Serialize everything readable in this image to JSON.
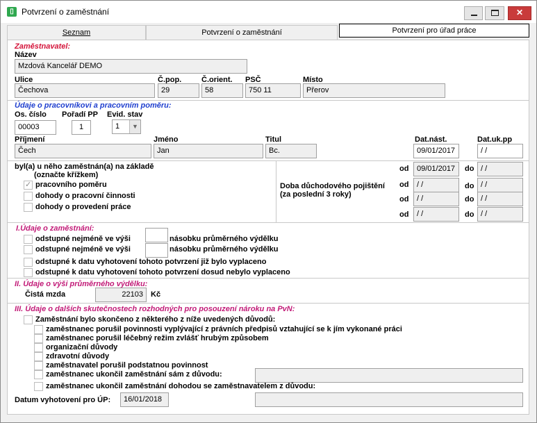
{
  "window": {
    "title": "Potvrzení o zaměstnání"
  },
  "tabs": [
    "Seznam",
    "Potvrzení o zaměstnání",
    "Potvrzení pro úřad práce"
  ],
  "employer": {
    "section": "Zaměstnavatel:",
    "name_label": "Název",
    "name": "Mzdová Kancelář DEMO",
    "street_label": "Ulice",
    "street": "Čechova",
    "cpop_label": "Č.pop.",
    "cpop": "29",
    "corient_label": "Č.orient.",
    "corient": "58",
    "psc_label": "PSČ",
    "psc": "750 11",
    "city_label": "Místo",
    "city": "Přerov"
  },
  "worker": {
    "section": "Údaje o pracovníkovi a pracovním poměru:",
    "oscislo_label": "Os. číslo",
    "oscislo": "00003",
    "poradi_label": "Pořadí PP",
    "poradi": "1",
    "evid_label": "Evid. stav",
    "evid": "1",
    "prijmeni_label": "Příjmení",
    "prijmeni": "Čech",
    "jmeno_label": "Jméno",
    "jmeno": "Jan",
    "titul_label": "Titul",
    "titul": "Bc.",
    "datnast_label": "Dat.nást.",
    "datnast": "09/01/2017",
    "datuk_label": "Dat.uk.pp",
    "datuk": " / /"
  },
  "basis": {
    "line1": "byl(a) u něho zaměstnán(a) na základě",
    "line2": "(označte křížkem)",
    "options": [
      "pracovního poměru",
      "dohody o pracovní činnosti",
      "dohody o provedení práce"
    ],
    "checked": [
      true,
      false,
      false
    ]
  },
  "pension": {
    "line1": "Doba důchodového pojištění",
    "line2": "(za poslední 3 roky)",
    "od_label": "od",
    "do_label": "do",
    "rows": [
      {
        "od": "09/01/2017",
        "do": " / /"
      },
      {
        "od": " / /",
        "do": " / /"
      },
      {
        "od": " / /",
        "do": " / /"
      },
      {
        "od": " / /",
        "do": " / /"
      }
    ]
  },
  "section1": {
    "title": "I.Údaje o zaměstnání:",
    "row1_a": "odstupné nejméně ve výši",
    "row1_b": "násobku průměrného výdělku",
    "row2_a": "odstupné nejméně ve výši",
    "row2_b": "násobku průměrného výdělku",
    "row3": "odstupné k datu vyhotovení tohoto potvrzení již bylo vyplaceno",
    "row4": "odstupné k datu vyhotovení tohoto potvrzení dosud nebylo vyplaceno"
  },
  "section2": {
    "title": "II. Údaje o výši průměrného výdělku:",
    "mzda_label": "Čistá mzda",
    "mzda": "22103",
    "currency": "Kč"
  },
  "section3": {
    "title": "III. Údaje o dalších skutečnostech rozhodných pro posouzení nároku na PvN:",
    "main": "Zaměstnání bylo skončeno z některého z níže uvedených důvodů:",
    "reasons": [
      "zaměstnanec porušil povinnosti vyplývající z právních předpisů vztahující se k jím vykonané práci",
      "zaměstnanec porušil léčebný režim zvlášť hrubým způsobem",
      "organizační důvody",
      "zdravotní důvody",
      "zaměstnavatel porušil podstatnou povinnost",
      "zaměstnanec ukončil zaměstnání sám z důvodu:",
      "zaměstnanec ukončil zaměstnání dohodou se zaměstnavatelem z důvodu:"
    ],
    "date_label": "Datum vyhotovení pro ÚP:",
    "date": "16/01/2018"
  }
}
